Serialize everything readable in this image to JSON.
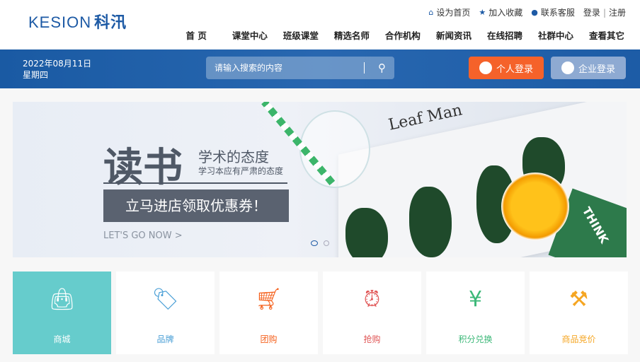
{
  "logo": {
    "text": "KESION",
    "cn": "科汛"
  },
  "toplinks": [
    {
      "icon": "home-icon",
      "label": "设为首页"
    },
    {
      "icon": "star-icon",
      "label": "加入收藏"
    },
    {
      "icon": "user-icon",
      "label": "联系客服"
    }
  ],
  "auth": {
    "login": "登录",
    "sep": "|",
    "register": "注册"
  },
  "nav": [
    "首 页",
    "课堂中心",
    "班级课堂",
    "精选名师",
    "合作机构",
    "新闻资讯",
    "在线招聘",
    "社群中心",
    "查看其它"
  ],
  "date": {
    "day": "2022年08月11日",
    "weekday": "星期四"
  },
  "search": {
    "placeholder": "请输入搜索的内容"
  },
  "buttons": {
    "personal": "个人登录",
    "enterprise": "企业登录"
  },
  "banner": {
    "title": "读书",
    "subtitle": "学术的态度",
    "tagline": "学习本应有严肃的态度",
    "coupon": "立马进店领取优惠券！",
    "cta": "LET'S GO NOW  >",
    "book": "Leaf Man",
    "book2": "THINK",
    "slides": 2,
    "active_slide": 1
  },
  "tiles": [
    {
      "label": "商城",
      "icon": "shopping-bag-icon",
      "color": "#ffffff",
      "bg": "#66cccc"
    },
    {
      "label": "品牌",
      "icon": "tag-icon",
      "color": "#4a9fd6"
    },
    {
      "label": "团购",
      "icon": "cart-icon",
      "color": "#f5621e"
    },
    {
      "label": "抢购",
      "icon": "alarm-clock-icon",
      "color": "#e05555"
    },
    {
      "label": "积分兑换",
      "icon": "yen-coin-icon",
      "color": "#3cb878"
    },
    {
      "label": "商品竞价",
      "icon": "auction-hammer-icon",
      "color": "#f5a623"
    }
  ]
}
